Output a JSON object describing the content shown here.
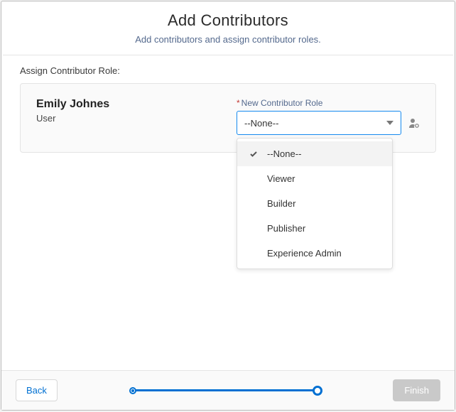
{
  "header": {
    "title": "Add Contributors",
    "subtitle": "Add contributors and assign contributor roles."
  },
  "section": {
    "label": "Assign Contributor Role:"
  },
  "contributor": {
    "name": "Emily Johnes",
    "type": "User"
  },
  "field": {
    "required_marker": "*",
    "label": "New Contributor Role",
    "value": "--None--"
  },
  "options": {
    "0": "--None--",
    "1": "Viewer",
    "2": "Builder",
    "3": "Publisher",
    "4": "Experience Admin"
  },
  "footer": {
    "back": "Back",
    "finish": "Finish"
  }
}
